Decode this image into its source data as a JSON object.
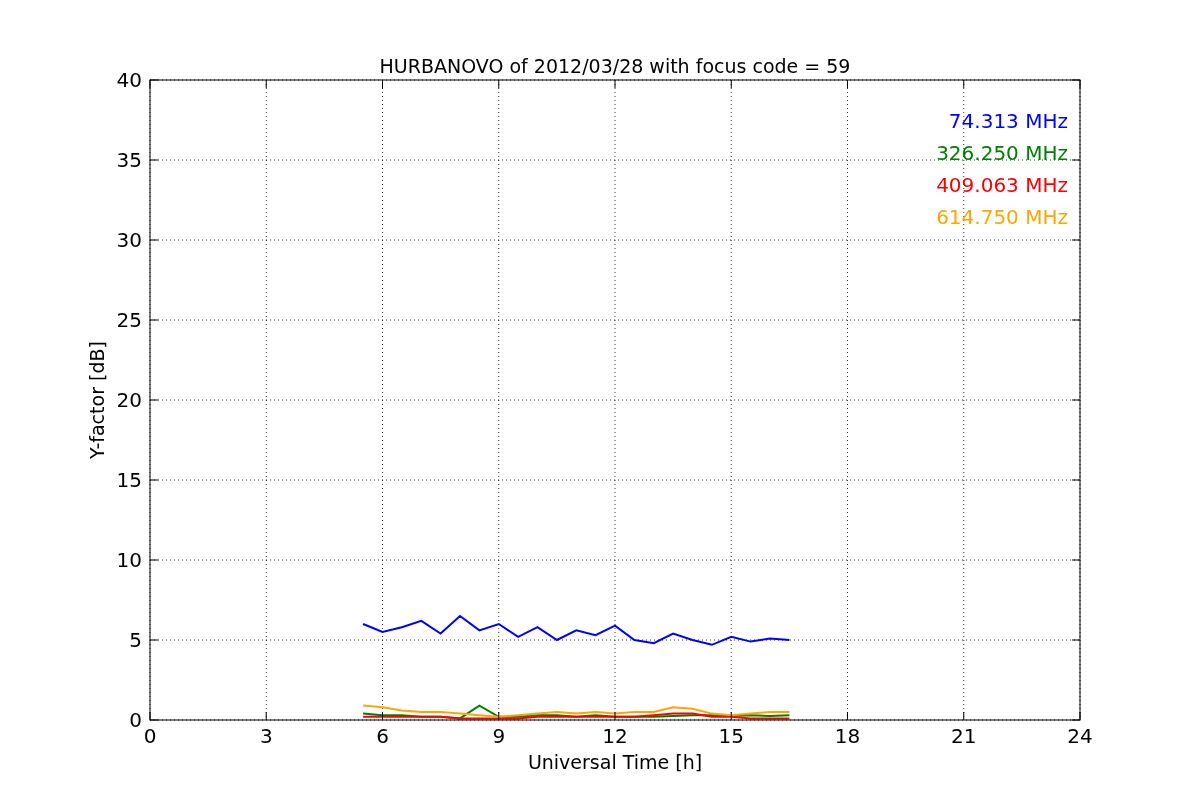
{
  "chart": {
    "chart_data": {
      "type": "line",
      "title": "HURBANOVO of 2012/03/28 with focus code = 59",
      "xlabel": "Universal Time [h]",
      "ylabel": "Y-factor [dB]",
      "x": [
        5.5,
        6,
        6.5,
        7,
        7.5,
        8,
        8.5,
        9,
        9.5,
        10,
        10.5,
        11,
        11.5,
        12,
        12.5,
        13,
        13.5,
        14,
        14.5,
        15,
        15.5,
        16,
        16.5
      ],
      "series": [
        {
          "name": "74.313 MHz",
          "color": "#0000ff",
          "values": [
            6.0,
            5.5,
            5.8,
            6.2,
            5.4,
            6.5,
            5.6,
            6.0,
            5.2,
            5.8,
            5.0,
            5.6,
            5.3,
            5.9,
            5.0,
            4.8,
            5.4,
            5.0,
            4.7,
            5.2,
            4.9,
            5.1,
            5.0
          ]
        },
        {
          "name": "326.250 MHz",
          "color": "#008000",
          "values": [
            0.4,
            0.3,
            0.3,
            0.2,
            0.2,
            0.1,
            0.9,
            0.2,
            0.2,
            0.3,
            0.3,
            0.2,
            0.3,
            0.2,
            0.2,
            0.2,
            0.25,
            0.3,
            0.3,
            0.25,
            0.3,
            0.25,
            0.3
          ]
        },
        {
          "name": "409.063 MHz",
          "color": "#ff0000",
          "values": [
            0.2,
            0.2,
            0.2,
            0.2,
            0.2,
            0.1,
            0.1,
            0.1,
            0.1,
            0.2,
            0.2,
            0.2,
            0.2,
            0.2,
            0.2,
            0.3,
            0.4,
            0.4,
            0.2,
            0.2,
            0.1,
            0.1,
            0.1
          ]
        },
        {
          "name": "614.750 MHz",
          "color": "#ffa500",
          "values": [
            0.9,
            0.8,
            0.6,
            0.5,
            0.5,
            0.4,
            0.3,
            0.2,
            0.3,
            0.4,
            0.5,
            0.4,
            0.5,
            0.4,
            0.5,
            0.5,
            0.8,
            0.7,
            0.4,
            0.3,
            0.4,
            0.5,
            0.5
          ]
        }
      ],
      "grid": true,
      "xlim": [
        0,
        24
      ],
      "ylim": [
        0,
        40
      ],
      "xticks": [
        0,
        3,
        6,
        9,
        12,
        15,
        18,
        21,
        24
      ],
      "yticks": [
        0,
        5,
        10,
        15,
        20,
        25,
        30,
        35,
        40
      ]
    }
  }
}
